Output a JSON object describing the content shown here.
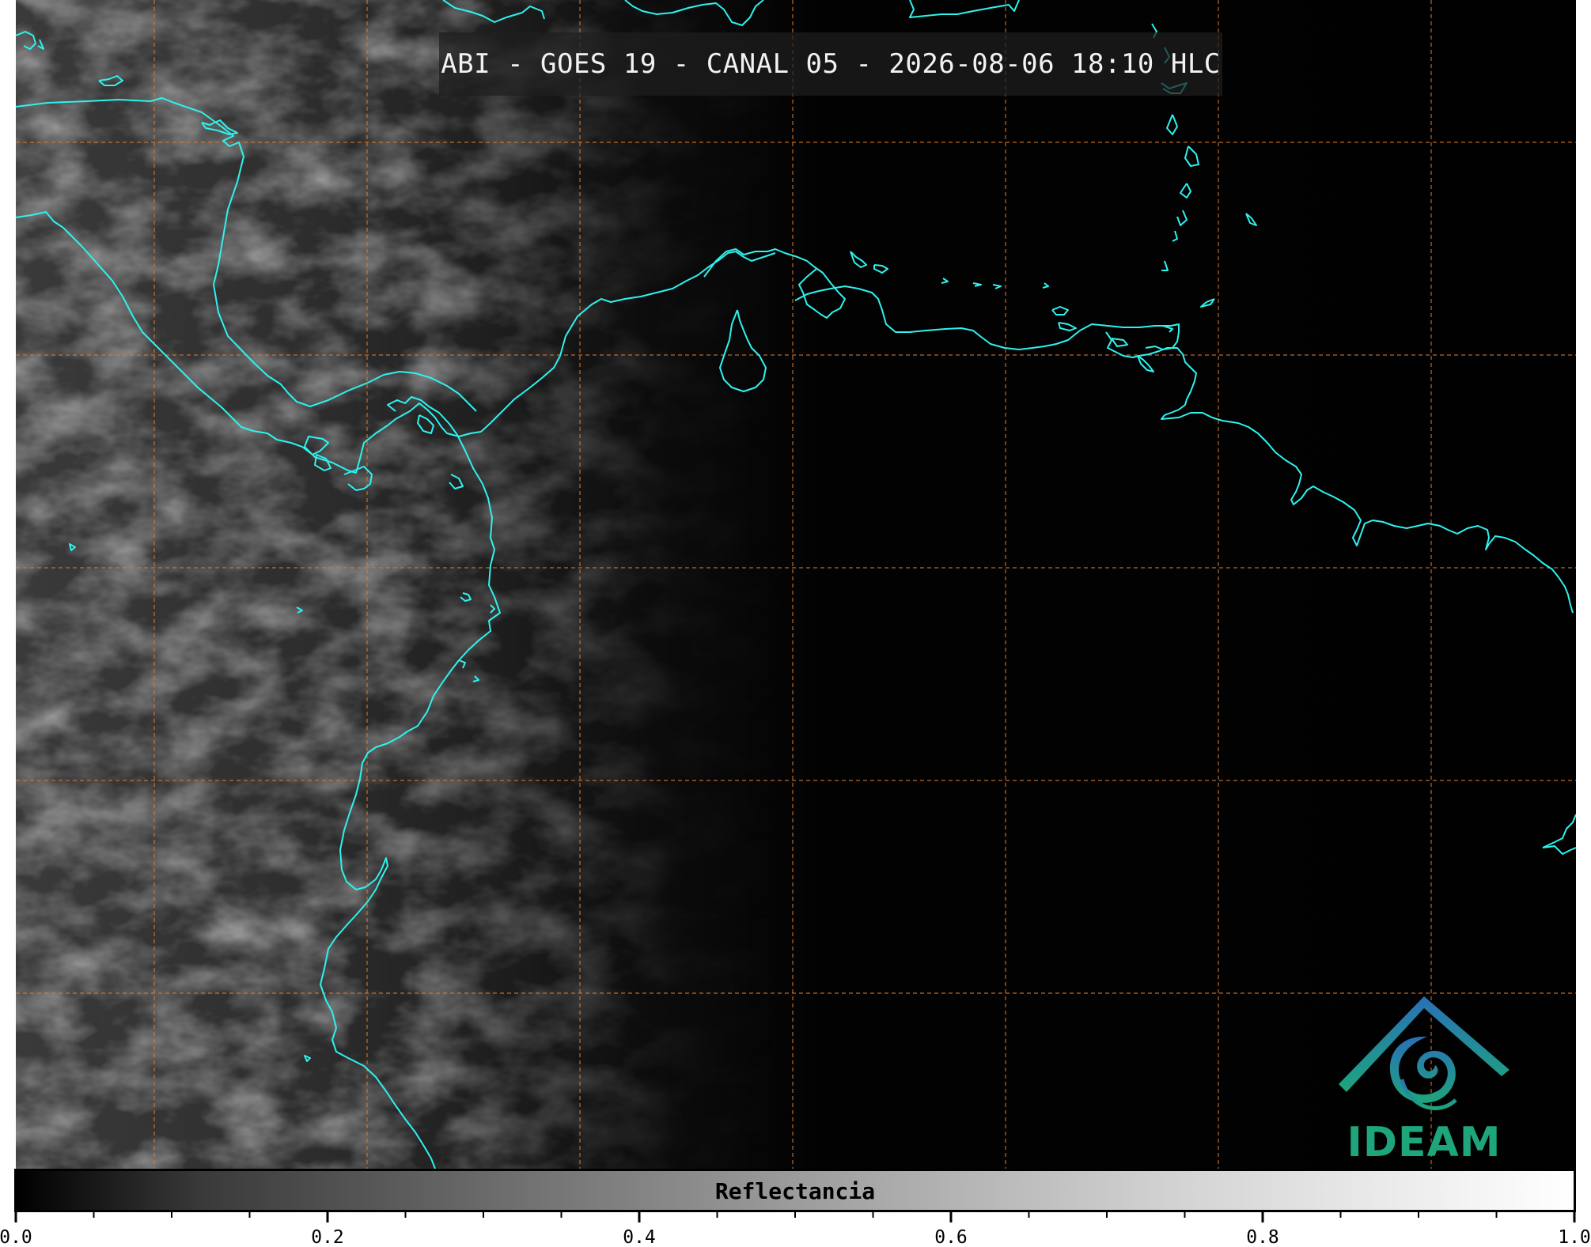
{
  "title": "ABI - GOES 19 - CANAL 05 - 2026-08-06 18:10 HLC",
  "logo": {
    "text": "IDEAM",
    "colors": {
      "mountain": "#2a70b8",
      "spiral": "#1b9f94",
      "text": "#1ea57c"
    }
  },
  "colorbar": {
    "label": "Reflectancia",
    "range": [
      0.0,
      1.0
    ],
    "colors": [
      "#000000",
      "#ffffff"
    ],
    "major_tick_labels": [
      "0.0",
      "0.2",
      "0.4",
      "0.6",
      "0.8",
      "1.0"
    ],
    "minor_tick_step": 0.05
  },
  "map": {
    "coastline_color": "#2ef2ee",
    "graticule_color": "#e07a2a",
    "graticule_style": "dashed",
    "background": "#010101"
  }
}
